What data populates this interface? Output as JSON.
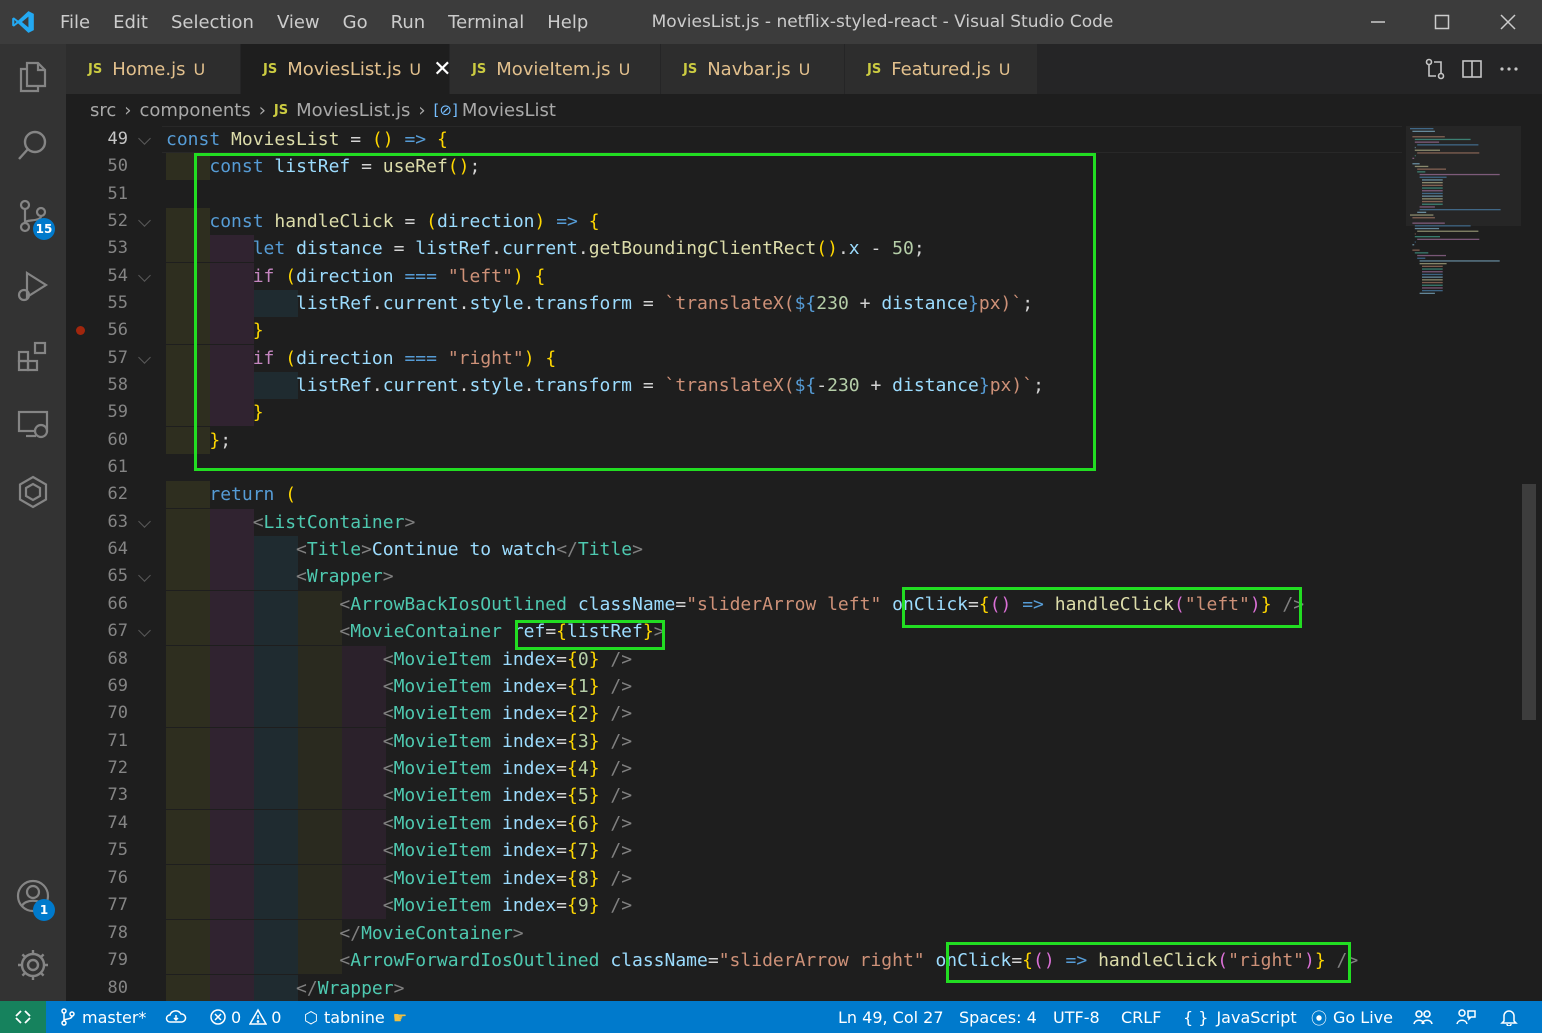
{
  "window": {
    "title": "MoviesList.js - netflix-styled-react - Visual Studio Code",
    "menu": [
      "File",
      "Edit",
      "Selection",
      "View",
      "Go",
      "Run",
      "Terminal",
      "Help"
    ]
  },
  "activity_bar": {
    "items": [
      "explorer-icon",
      "search-icon",
      "source-control-icon",
      "run-debug-icon",
      "extensions-icon",
      "remote-explorer-icon",
      "tabnine-icon"
    ],
    "source_control_badge": "15",
    "accounts_badge": "1"
  },
  "tabs": [
    {
      "icon_label": "JS",
      "name": "Home.js",
      "status": "U",
      "active": false
    },
    {
      "icon_label": "JS",
      "name": "MoviesList.js",
      "status": "U",
      "active": true
    },
    {
      "icon_label": "JS",
      "name": "MovieItem.js",
      "status": "U",
      "active": false
    },
    {
      "icon_label": "JS",
      "name": "Navbar.js",
      "status": "U",
      "active": false
    },
    {
      "icon_label": "JS",
      "name": "Featured.js",
      "status": "U",
      "active": false
    }
  ],
  "breadcrumb": {
    "items": [
      "src",
      "components",
      "MoviesList.js",
      "MoviesList"
    ],
    "file_icon_label": "JS"
  },
  "editor": {
    "current_line": 49,
    "breakpoint_line": 56,
    "lines": [
      {
        "n": "49",
        "text": "const MoviesList = () => {"
      },
      {
        "n": "50",
        "text": "    const listRef = useRef();"
      },
      {
        "n": "51",
        "text": ""
      },
      {
        "n": "52",
        "text": "    const handleClick = (direction) => {"
      },
      {
        "n": "53",
        "text": "        let distance = listRef.current.getBoundingClientRect().x - 50;"
      },
      {
        "n": "54",
        "text": "        if (direction === \"left\") {"
      },
      {
        "n": "55",
        "text": "            listRef.current.style.transform = `translateX(${230 + distance}px)`;"
      },
      {
        "n": "56",
        "text": "        }"
      },
      {
        "n": "57",
        "text": "        if (direction === \"right\") {"
      },
      {
        "n": "58",
        "text": "            listRef.current.style.transform = `translateX(${-230 + distance}px)`;"
      },
      {
        "n": "59",
        "text": "        }"
      },
      {
        "n": "60",
        "text": "    };"
      },
      {
        "n": "61",
        "text": ""
      },
      {
        "n": "62",
        "text": "    return ("
      },
      {
        "n": "63",
        "text": "        <ListContainer>"
      },
      {
        "n": "64",
        "text": "            <Title>Continue to watch</Title>"
      },
      {
        "n": "65",
        "text": "            <Wrapper>"
      },
      {
        "n": "66",
        "text": "                <ArrowBackIosOutlined className=\"sliderArrow left\" onClick={() => handleClick(\"left\")} />"
      },
      {
        "n": "67",
        "text": "                <MovieContainer ref={listRef}>"
      },
      {
        "n": "68",
        "text": "                    <MovieItem index={0} />"
      },
      {
        "n": "69",
        "text": "                    <MovieItem index={1} />"
      },
      {
        "n": "70",
        "text": "                    <MovieItem index={2} />"
      },
      {
        "n": "71",
        "text": "                    <MovieItem index={3} />"
      },
      {
        "n": "72",
        "text": "                    <MovieItem index={4} />"
      },
      {
        "n": "73",
        "text": "                    <MovieItem index={5} />"
      },
      {
        "n": "74",
        "text": "                    <MovieItem index={6} />"
      },
      {
        "n": "75",
        "text": "                    <MovieItem index={7} />"
      },
      {
        "n": "76",
        "text": "                    <MovieItem index={8} />"
      },
      {
        "n": "77",
        "text": "                    <MovieItem index={9} />"
      },
      {
        "n": "78",
        "text": "                </MovieContainer>"
      },
      {
        "n": "79",
        "text": "                <ArrowForwardIosOutlined className=\"sliderArrow right\" onClick={() => handleClick(\"right\")} />"
      },
      {
        "n": "80",
        "text": "            </Wrapper>"
      }
    ]
  },
  "status_bar": {
    "branch": "master*",
    "errors": "0",
    "warnings": "0",
    "tabnine": "tabnine",
    "cursor": "Ln 49, Col 27",
    "spaces": "Spaces: 4",
    "encoding": "UTF-8",
    "eol": "CRLF",
    "language_icon": "{ }",
    "language": "JavaScript",
    "go_live": "Go Live"
  },
  "colors": {
    "highlight_box": "#22dd22",
    "status_bar": "#007acc",
    "remote_button": "#16825d",
    "modified_tab_text": "#e2c08d"
  }
}
